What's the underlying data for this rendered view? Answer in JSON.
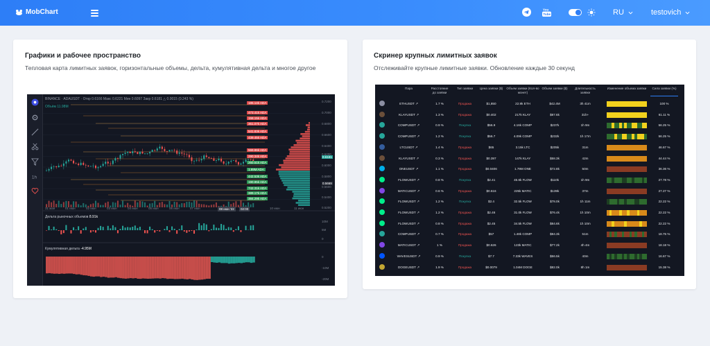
{
  "header": {
    "logo_text": "MobChart",
    "language": "RU",
    "username": "testovich"
  },
  "left_card": {
    "title": "Графики и рабочее пространство",
    "description": "Тепловая карта лимитных заявок, горизонтальные объемы, дельта, кумулятивная дельта и многое другое",
    "chart": {
      "info_line": "BINANCE · ADAUSDT · Откр 0.6166 Макс 0.6221 Мин 0.6097 Закр 0.6181 △ 0.0015 (0.243 %)",
      "volume_label": "Объём 11.98M",
      "market_delta_label": "Дельта рыночных объемов",
      "market_delta_value": "8.91k",
      "cum_delta_label": "Кумулятивная дельта",
      "cum_delta_value": "-4.95M",
      "price_levels": [
        "185.14k ADA",
        "473.41k ADA",
        "158.15k ADA",
        "361.07k ADA",
        "541.83k ADA",
        "439.45k ADA",
        "569.86k ADA",
        "290.34k ADA",
        "260.51k ADA",
        "1.89M ADA",
        "442.53k ADA",
        "190.95k ADA",
        "742.31k ADA",
        "389.17k ADA",
        "384.29k ADA"
      ],
      "y_ticks": [
        "0.7200",
        "0.7000",
        "0.6800",
        "0.6600",
        "0.6400",
        "0.6200",
        "0.6181",
        "0.6000",
        "0.5800",
        "0.5669",
        "0.5600",
        "0.5400",
        "0.5200"
      ],
      "x_ticks": [
        "31 мая",
        "01 июн",
        "02 июн",
        "03 июн",
        "04 июн",
        "05 июн",
        "06 июн",
        "07 июн",
        "08 июн '22",
        "02:00",
        "10 июн",
        "11 июн"
      ],
      "delta_ticks": [
        "10M",
        "5M",
        "0"
      ],
      "cum_ticks": [
        "0",
        "-10M",
        "-20M"
      ]
    }
  },
  "right_card": {
    "title": "Скринер крупных лимитных заявок",
    "description": "Отслеживайте крупные лимитные заявки. Обновление каждые 30 секунд",
    "columns": [
      "Пара",
      "Расстояние до заявки",
      "Тип заявки",
      "Цена заявки ($)",
      "Объем заявки (Кол-во монет)",
      "Объем заявки ($)",
      "Длительность заявки",
      "Изменение объема заявки",
      "Сила заявки (%)"
    ],
    "rows": [
      {
        "pair": "ETHUSDT",
        "dist": "1.7 %",
        "type": "Продажа",
        "price": "$1,850",
        "vcoin": "22.9k ETH",
        "vusd": "$42.4M",
        "dur": "3h 41m",
        "pct": "100 %",
        "color": "#8c8fa3",
        "heat": "yyyyyyyyyyyyyyyy"
      },
      {
        "pair": "KLAYUSDT",
        "dist": "1.3 %",
        "type": "Продажа",
        "price": "$0.402",
        "vcoin": "217k KLAY",
        "vusd": "$87.6k",
        "dur": "31h+",
        "pct": "61.11 %",
        "color": "#6b4f3a",
        "heat": "yyyyyyyyyyyyyyyy"
      },
      {
        "pair": "COMPUSDT",
        "dist": "0.9 %",
        "type": "Покупка",
        "price": "$56.9",
        "vcoin": "4.16k COMP",
        "vusd": "$237k",
        "dur": "1h 9m",
        "pct": "56.25 %",
        "color": "#26a69a",
        "heat": "ggyggygyggyyggyy"
      },
      {
        "pair": "COMPUSDT",
        "dist": "1.2 %",
        "type": "Покупка",
        "price": "$56.7",
        "vcoin": "4.09k COMP",
        "vusd": "$232k",
        "dur": "1h 17m",
        "pct": "56.25 %",
        "color": "#26a69a",
        "heat": "gggyggyyggygyyyg"
      },
      {
        "pair": "LTCUSDT",
        "dist": "1.4 %",
        "type": "Продажа",
        "price": "$65",
        "vcoin": "3.15k LTC",
        "vusd": "$205k",
        "dur": "31m",
        "pct": "46.67 %",
        "color": "#345d9d",
        "heat": "oooooooooooooooo"
      },
      {
        "pair": "KLAYUSDT",
        "dist": "0.3 %",
        "type": "Продажа",
        "price": "$0.397",
        "vcoin": "147k KLAY",
        "vusd": "$58.3k",
        "dur": "42m",
        "pct": "44.44 %",
        "color": "#6b4f3a",
        "heat": "oooooooooooooooo"
      },
      {
        "pair": "ONEUSDT",
        "dist": "1.1 %",
        "type": "Продажа",
        "price": "$0.0406",
        "vcoin": "1.79M ONE",
        "vusd": "$72.8k",
        "dur": "50m",
        "pct": "36.36 %",
        "color": "#00aee9",
        "heat": "rrrrrrrrrrrrrrrr"
      },
      {
        "pair": "FLOWUSDT",
        "dist": "0.8 %",
        "type": "Покупка",
        "price": "$2.41",
        "vcoin": "45.6k FLOW",
        "vusd": "$110k",
        "dur": "1h 9m",
        "pct": "27.78 %",
        "color": "#00ef8b",
        "heat": "ggdgggddggdgggdg"
      },
      {
        "pair": "MATICUSDT",
        "dist": "0.6 %",
        "type": "Продажа",
        "price": "$0.616",
        "vcoin": "225k MATIC",
        "vusd": "$139k",
        "dur": "37m",
        "pct": "27.27 %",
        "color": "#8247e5",
        "heat": "rrrrrrrrrrrrrrrr"
      },
      {
        "pair": "FLOWUSDT",
        "dist": "1.2 %",
        "type": "Покупка",
        "price": "$2.4",
        "vcoin": "32.5k FLOW",
        "vusd": "$78.0k",
        "dur": "1h 11m",
        "pct": "22.22 %",
        "color": "#00ef8b",
        "heat": "dgggdggdgggddggg"
      },
      {
        "pair": "FLOWUSDT",
        "dist": "1.2 %",
        "type": "Продажа",
        "price": "$2.46",
        "vcoin": "31.0k FLOW",
        "vusd": "$76.4k",
        "dur": "1h 10m",
        "pct": "22.22 %",
        "color": "#00ef8b",
        "heat": "oyoooyooyoooyooo"
      },
      {
        "pair": "FLOWUSDT",
        "dist": "0.8 %",
        "type": "Продажа",
        "price": "$2.45",
        "vcoin": "34.5k FLOW",
        "vusd": "$84.6k",
        "dur": "1h 10m",
        "pct": "22.22 %",
        "color": "#00ef8b",
        "heat": "ooyooooyoooooyoo"
      },
      {
        "pair": "COMPUSDT",
        "dist": "0.7 %",
        "type": "Продажа",
        "price": "$57",
        "vcoin": "1.48k COMP",
        "vusd": "$84.3k",
        "dur": "51m",
        "pct": "18.75 %",
        "color": "#26a69a",
        "heat": "rgrgrrgrrgrgrrgr"
      },
      {
        "pair": "MATICUSDT",
        "dist": "1 %",
        "type": "Продажа",
        "price": "$0.626",
        "vcoin": "123k MATIC",
        "vusd": "$77.2k",
        "dur": "4h 4m",
        "pct": "18.18 %",
        "color": "#8247e5",
        "heat": "rrrrrrrrrrrrrrrr"
      },
      {
        "pair": "WAVESUSDT",
        "dist": "0.9 %",
        "type": "Покупка",
        "price": "$7.7",
        "vcoin": "7.33k WAVES",
        "vusd": "$56.5k",
        "dur": "40m",
        "pct": "16.67 %",
        "color": "#0155ff",
        "heat": "gdgdggdgdggdgdgg"
      },
      {
        "pair": "DOGEUSDT",
        "dist": "1.9 %",
        "type": "Продажа",
        "price": "$0.0079",
        "vcoin": "1.04M DOGE",
        "vusd": "$82.0k",
        "dur": "8h 1m",
        "pct": "15.38 %",
        "color": "#c2a633",
        "heat": "rrrrrrrrrrrrrrrr"
      }
    ]
  },
  "colors": {
    "accent": "#2d7ef7",
    "chart_bg": "#131722",
    "up": "#26a69a",
    "down": "#ef5350"
  }
}
